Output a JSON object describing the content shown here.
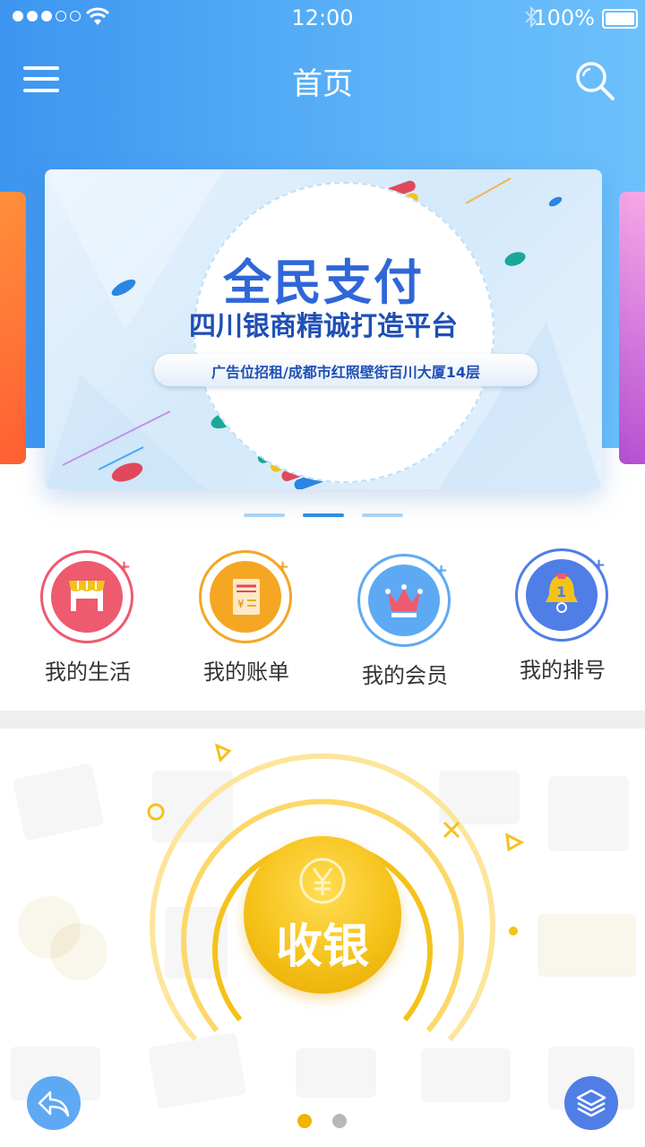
{
  "status_bar": {
    "time": "12:00",
    "battery_text": "100%",
    "signal_icon": "signal-dots-icon",
    "wifi_icon": "wifi-icon",
    "bluetooth_icon": "bluetooth-icon"
  },
  "header": {
    "title": "首页",
    "menu_icon": "hamburger-menu-icon",
    "search_icon": "search-icon",
    "background_color": "#4aa6f5"
  },
  "banner": {
    "title": "全民支付",
    "subtitle": "四川银商精诚打造平台",
    "tagline": "广告位招租/成都市红照壁街百川大厦14层",
    "active_slide": 2,
    "slide_count": 3
  },
  "quick_menu": [
    {
      "label": "我的生活",
      "icon": "shop-icon",
      "color": "#ee5a6e"
    },
    {
      "label": "我的账单",
      "icon": "bill-icon",
      "color": "#f5a623"
    },
    {
      "label": "我的会员",
      "icon": "crown-icon",
      "color": "#5ea9f4"
    },
    {
      "label": "我的排号",
      "icon": "bell-icon",
      "color": "#4f7ee6"
    }
  ],
  "cashier": {
    "label": "收银",
    "icon": "yen-coin-icon",
    "color": "#f5c21a"
  },
  "bottom_bar": {
    "back_icon": "back-arrow-icon",
    "layers_icon": "layers-icon",
    "active_page": 1,
    "page_count": 2
  }
}
